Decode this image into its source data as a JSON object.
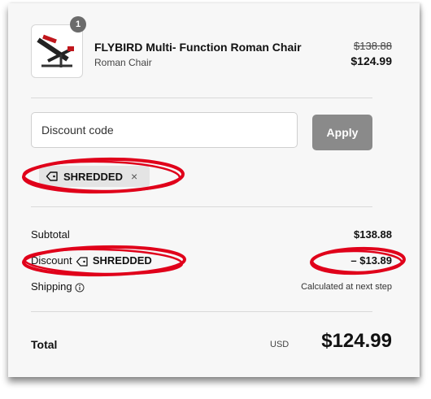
{
  "cart_item": {
    "quantity": "1",
    "name": "FLYBIRD Multi- Function Roman Chair",
    "variant": "Roman Chair",
    "original_price": "$138.88",
    "price": "$124.99"
  },
  "discount": {
    "placeholder": "Discount code",
    "apply_label": "Apply",
    "applied_code": "SHREDDED",
    "remove_symbol": "×"
  },
  "summary": {
    "subtotal_label": "Subtotal",
    "subtotal_value": "$138.88",
    "discount_label": "Discount",
    "discount_code": "SHREDDED",
    "discount_value": "– $13.89",
    "shipping_label": "Shipping",
    "shipping_value": "Calculated at next step",
    "total_label": "Total",
    "currency": "USD",
    "total_value": "$124.99"
  },
  "colors": {
    "annotation": "#e0001a",
    "apply_button": "#8a8a8a",
    "tag_background": "#e4e4e4"
  }
}
